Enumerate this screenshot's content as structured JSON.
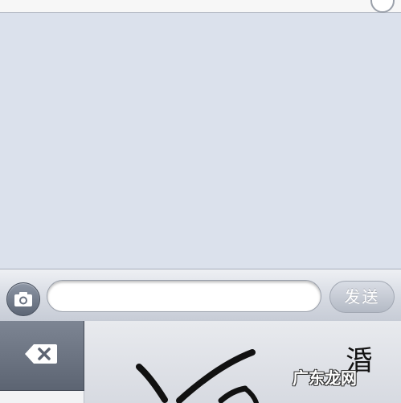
{
  "input_bar": {
    "send_label": "发送",
    "camera_icon": "camera-icon"
  },
  "keyboard": {
    "delete_icon": "backspace-icon",
    "candidate": "涽",
    "watermark": "广东龙网"
  },
  "colors": {
    "background": "#dbe1ec",
    "send_button": "#b4bac5",
    "delete_key": "#5c6472"
  }
}
